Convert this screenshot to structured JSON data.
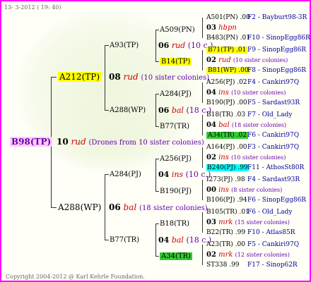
{
  "header": {
    "date": "13- 3-2012 ( 19: 40)"
  },
  "footer": {
    "copyright": "Copyright 2004-2012 @ Karl Kehrle Foundation."
  },
  "root": {
    "id": "B98(TP)",
    "gen": "10",
    "race": "rud",
    "note": "(Drones from 10 sister colonies)"
  },
  "l1": [
    {
      "id": "A212(TP)",
      "gen": "08",
      "race": "rud",
      "note": "(10 sister colonies)"
    },
    {
      "id": "A288(WP)",
      "gen": "06",
      "race": "bal",
      "note": "(18 sister colonies)"
    }
  ],
  "l2": [
    {
      "id": "A93(TP)",
      "gen": "06",
      "race": "rud",
      "note": "(10 c.)"
    },
    {
      "id": "A288(WP)",
      "gen": "06",
      "race": "bal",
      "note": "(18 c.)"
    },
    {
      "id": "A284(PJ)",
      "gen": "04",
      "race": "ins",
      "note": "(10 c.)"
    },
    {
      "id": "B77(TR)",
      "gen": "04",
      "race": "bal",
      "note": "(18 c.)"
    }
  ],
  "l3": [
    "A509(PN)",
    "B14(TP)",
    "A284(PJ)",
    "B77(TR)",
    "A256(PJ)",
    "B190(PJ)",
    "B18(TR)",
    "A34(TR)"
  ],
  "l4": [
    {
      "top": "A501(PN)  .00",
      "topr": "F2 - Bayburt98-3R",
      "mid_gen": "03",
      "mid_race": "hbpn",
      "mid_note": "",
      "bot": "B483(PN)  .01",
      "botr": "F10 - SinopEgg86R"
    },
    {
      "top": "B71(TP)  .01",
      "topr": "F9 - SinopEgg86R",
      "mid_gen": "02",
      "mid_race": "rud",
      "mid_note": "(10 sister colonies)",
      "bot": "B81(WP)  .00",
      "botr": "F8 - SinopEgg86R"
    },
    {
      "top": "A256(PJ)  .02",
      "topr": "F4 - Cankiri97Q",
      "mid_gen": "04",
      "mid_race": "ins",
      "mid_note": "(10 sister colonies)",
      "bot": "B190(PJ)  .00",
      "botr": "F5 - Sardast93R"
    },
    {
      "top": "B18(TR)  .03",
      "topr": "F7 - Old_Lady",
      "mid_gen": "04",
      "mid_race": "bal",
      "mid_note": "(18 sister colonies)",
      "bot": "A34(TR)  .02",
      "botr": "F6 - Cankiri97Q"
    },
    {
      "top": "A164(PJ)  .00",
      "topr": "F3 - Cankiri97Q",
      "mid_gen": "02",
      "mid_race": "ins",
      "mid_note": "(10 sister colonies)",
      "bot": "B240(PJ)  .99",
      "botr": "F11 - AthosSt80R"
    },
    {
      "top": "I273(PJ)  .98",
      "topr": "F4 - Sardast93R",
      "mid_gen": "00",
      "mid_race": "ins",
      "mid_note": "(8 sister colonies)",
      "bot": "B106(PJ)  .94",
      "botr": "F6 - SinopEgg86R"
    },
    {
      "top": "B105(TR)  .01",
      "topr": "F6 - Old_Lady",
      "mid_gen": "03",
      "mid_race": "mrk",
      "mid_note": "(15 sister colonies)",
      "bot": "B22(TR)  .99",
      "botr": "F10 - Atlas85R"
    },
    {
      "top": "A23(TR)  .00",
      "topr": "F5 - Cankiri97Q",
      "mid_gen": "02",
      "mid_race": "mrk",
      "mid_note": "(12 sister colonies)",
      "bot": "ST338  .99",
      "botr": "F17 - Sinop62R"
    }
  ]
}
